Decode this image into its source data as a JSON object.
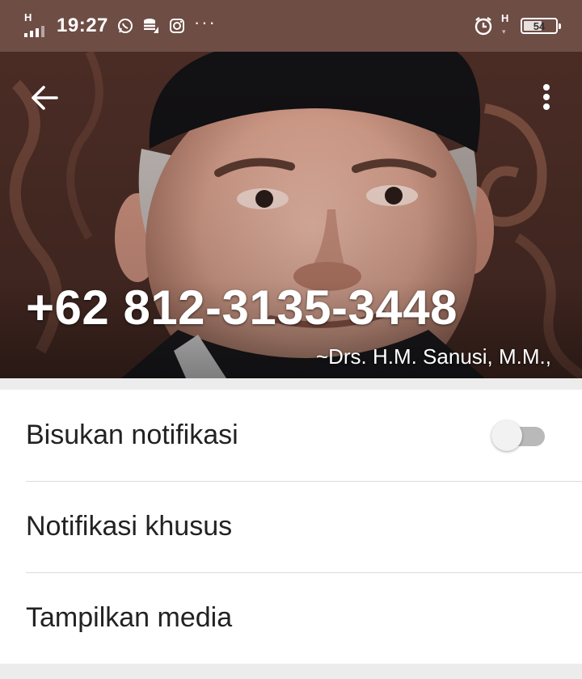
{
  "status_bar": {
    "time": "19:27",
    "network_type": "H",
    "network_type_2": "H",
    "battery_level": "54",
    "more_indicator": "···",
    "icons": [
      "whatsapp-icon",
      "data-saver-icon",
      "instagram-icon",
      "alarm-icon"
    ],
    "background_color": "#6e4d45"
  },
  "header": {
    "phone_number": "+62 812-3135-3448",
    "contact_name": "~Drs. H.M. Sanusi, M.M.,",
    "back_icon": "arrow-left-icon",
    "menu_icon": "more-vertical-icon"
  },
  "settings": [
    {
      "label": "Bisukan notifikasi",
      "toggle": false
    },
    {
      "label": "Notifikasi khusus"
    },
    {
      "label": "Tampilkan media"
    }
  ]
}
